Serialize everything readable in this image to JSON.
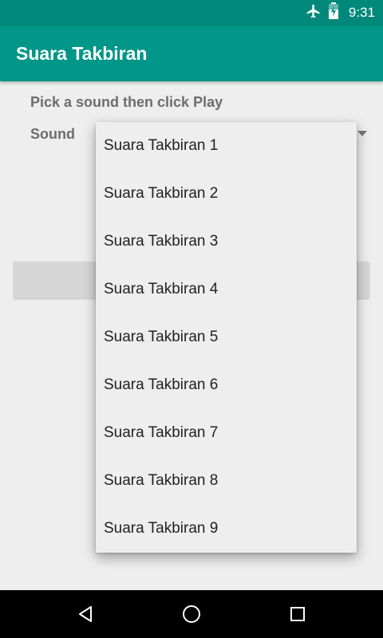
{
  "status_bar": {
    "time": "9:31",
    "icons": [
      "airplane-mode-icon",
      "battery-charging-icon"
    ]
  },
  "app_bar": {
    "title": "Suara Takbiran",
    "color": "#009688"
  },
  "main": {
    "instruction": "Pick a sound then click Play",
    "sound_label": "Sound"
  },
  "dropdown": {
    "options": [
      "Suara Takbiran 1",
      "Suara Takbiran 2",
      "Suara Takbiran 3",
      "Suara Takbiran 4",
      "Suara Takbiran 5",
      "Suara Takbiran 6",
      "Suara Takbiran 7",
      "Suara Takbiran 8",
      "Suara Takbiran 9"
    ]
  },
  "nav_bar": {
    "icons": [
      "back-icon",
      "home-icon",
      "recents-icon"
    ]
  }
}
